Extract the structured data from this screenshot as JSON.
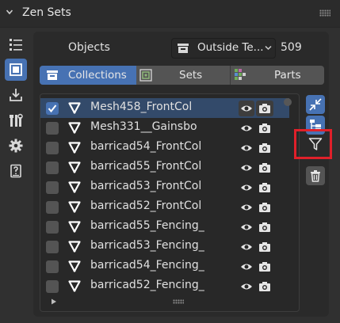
{
  "panel": {
    "title": "Zen Sets"
  },
  "left_tabs": [
    {
      "icon": "list-icon",
      "active": false
    },
    {
      "icon": "object-select-icon",
      "active": true
    },
    {
      "icon": "import-icon",
      "active": false
    },
    {
      "icon": "tools-icon",
      "active": false
    },
    {
      "icon": "gear-icon",
      "active": false
    },
    {
      "icon": "help-book-icon",
      "active": false
    }
  ],
  "mode": {
    "label": "Objects",
    "dropdown_value": "Outside Te...",
    "count": "509"
  },
  "tabs": [
    {
      "label": "Collections",
      "icon": "collection-icon",
      "active": true
    },
    {
      "label": "Sets",
      "icon": "sets-icon",
      "active": false
    },
    {
      "label": "Parts",
      "icon": "parts-icon",
      "active": false
    }
  ],
  "rows": [
    {
      "name": "Mesh458_FrontCol",
      "checked": true,
      "selected": true
    },
    {
      "name": "Mesh331__Gainsbo",
      "checked": false,
      "selected": false
    },
    {
      "name": "barricad54_FrontCol",
      "checked": false,
      "selected": false
    },
    {
      "name": "barricad55_FrontCol",
      "checked": false,
      "selected": false
    },
    {
      "name": "barricad53_FrontCol",
      "checked": false,
      "selected": false
    },
    {
      "name": "barricad52_FrontCol",
      "checked": false,
      "selected": false
    },
    {
      "name": "barricad55_Fencing_",
      "checked": false,
      "selected": false
    },
    {
      "name": "barricad53_Fencing_",
      "checked": false,
      "selected": false
    },
    {
      "name": "barricad54_Fencing_",
      "checked": false,
      "selected": false
    },
    {
      "name": "barricad52_Fencing_",
      "checked": false,
      "selected": false
    }
  ],
  "right_tools": [
    {
      "icon": "collapse-icon",
      "style": "blue"
    },
    {
      "icon": "hierarchy-icon",
      "style": "blue"
    },
    {
      "icon": "filter-icon",
      "style": "none"
    },
    {
      "icon": "trash-icon",
      "style": "gray"
    }
  ],
  "colors": {
    "accent": "#4772b3",
    "highlight": "#e0202a",
    "panel": "#303030"
  }
}
